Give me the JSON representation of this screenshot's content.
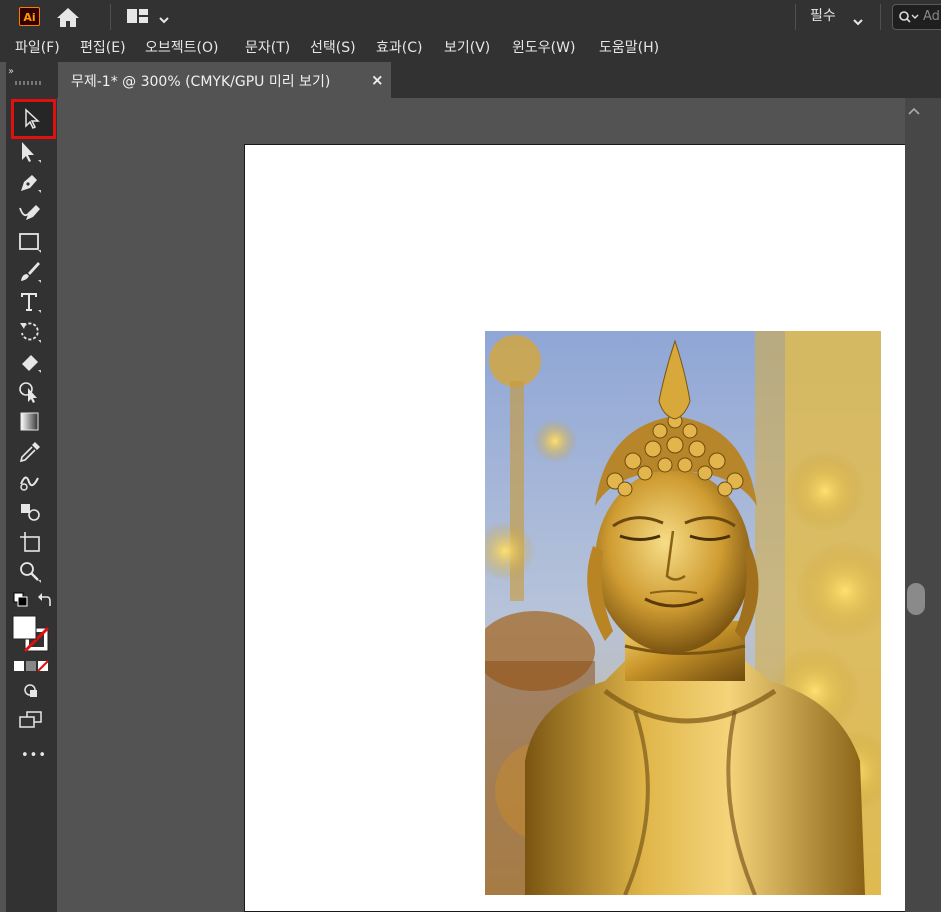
{
  "app": {
    "logo_text": "Ai",
    "accent": "#ff9a00"
  },
  "titlebar": {
    "workspace": "필수",
    "search_placeholder": "Ad"
  },
  "menu": [
    "파일(F)",
    "편집(E)",
    "오브젝트(O)",
    "문자(T)",
    "선택(S)",
    "효과(C)",
    "보기(V)",
    "윈도우(W)",
    "도움말(H)"
  ],
  "document": {
    "tab_title": "무제-1* @ 300% (CMYK/GPU 미리 보기)",
    "close_glyph": "×"
  },
  "tools": [
    "selection-tool",
    "direct-selection-tool",
    "pen-tool",
    "curvature-tool",
    "rectangle-tool",
    "paintbrush-tool",
    "type-tool",
    "rotate-tool",
    "eraser-tool",
    "shape-builder-tool",
    "gradient-tool",
    "eyedropper-tool",
    "blend-tool",
    "symbol-sprayer-tool",
    "artboard-tool",
    "zoom-tool"
  ],
  "toolbar": {
    "more_glyph": "•••",
    "collapse_glyph": "››"
  },
  "colors": {
    "selected_outline": "#e01010"
  }
}
